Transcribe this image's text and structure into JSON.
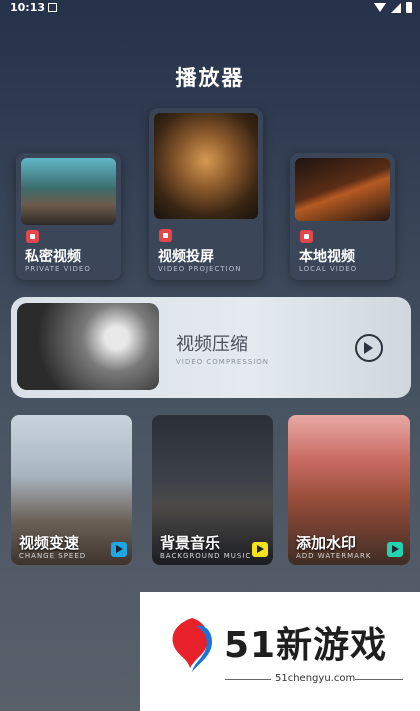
{
  "status_bar": {
    "time": "10:13"
  },
  "page": {
    "title": "播放器"
  },
  "top_cards": [
    {
      "label": "私密视频",
      "sub": "PRIVATE VIDEO"
    },
    {
      "label": "视频投屏",
      "sub": "VIDEO PROJECTION"
    },
    {
      "label": "本地视频",
      "sub": "LOCAL VIDEO"
    }
  ],
  "compress": {
    "label": "视频压缩",
    "sub": "VIDEO COMPRESSION"
  },
  "features": [
    {
      "label": "视频变速",
      "sub": "CHANGE SPEED",
      "tag_color": "#1ea7e8"
    },
    {
      "label": "背景音乐",
      "sub": "BACKGROUND MUSIC",
      "tag_color": "#f5e21a"
    },
    {
      "label": "添加水印",
      "sub": "ADD WATERMARK",
      "tag_color": "#22d3b0"
    }
  ],
  "watermark": {
    "title": "51新游戏",
    "url": "51chengyu.com"
  }
}
